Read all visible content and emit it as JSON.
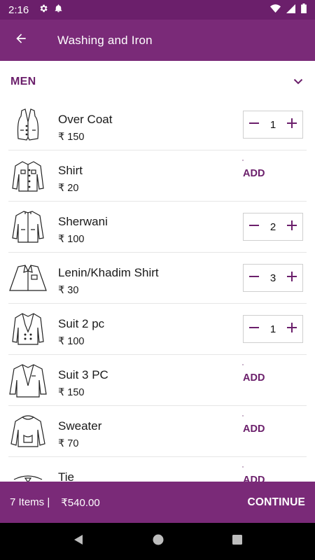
{
  "status_bar": {
    "time": "2:16",
    "left_icons": [
      "gear-icon",
      "notification-bell-icon"
    ],
    "right_icons": [
      "wifi-icon",
      "cellular-signal-icon",
      "battery-icon"
    ]
  },
  "app_bar": {
    "back_icon": "arrow-back-icon",
    "title": "Washing and Iron"
  },
  "category": {
    "label": "MEN",
    "toggle_icon": "chevron-down-icon"
  },
  "items": [
    {
      "name": "Over Coat",
      "price": "₹ 150",
      "quantity": "1",
      "icon": "waistcoat-icon"
    },
    {
      "name": "Shirt",
      "price": "₹ 20",
      "add_label": "ADD",
      "icon": "shirt-icon"
    },
    {
      "name": "Sherwani",
      "price": "₹ 100",
      "quantity": "2",
      "icon": "sherwani-icon"
    },
    {
      "name": "Lenin/Khadim Shirt",
      "price": "₹ 30",
      "quantity": "3",
      "icon": "folded-shirt-icon"
    },
    {
      "name": "Suit 2 pc",
      "price": "₹ 100",
      "quantity": "1",
      "icon": "suit-icon"
    },
    {
      "name": "Suit 3 PC",
      "price": "₹ 150",
      "add_label": "ADD",
      "icon": "blazer-icon"
    },
    {
      "name": "Sweater",
      "price": "₹ 70",
      "add_label": "ADD",
      "icon": "sweater-icon"
    },
    {
      "name": "Tie",
      "price": "",
      "add_label": "ADD",
      "icon": "tie-icon"
    }
  ],
  "cart": {
    "items_count": "7 Items |",
    "total": "₹540.00",
    "continue_label": "CONTINUE"
  },
  "nav_bar": {
    "icons": [
      "nav-back-icon",
      "nav-home-icon",
      "nav-recents-icon"
    ]
  },
  "colors": {
    "primary": "#7a2a78",
    "status_bar": "#6b1f6b",
    "accent_text": "#6b1f6b"
  }
}
